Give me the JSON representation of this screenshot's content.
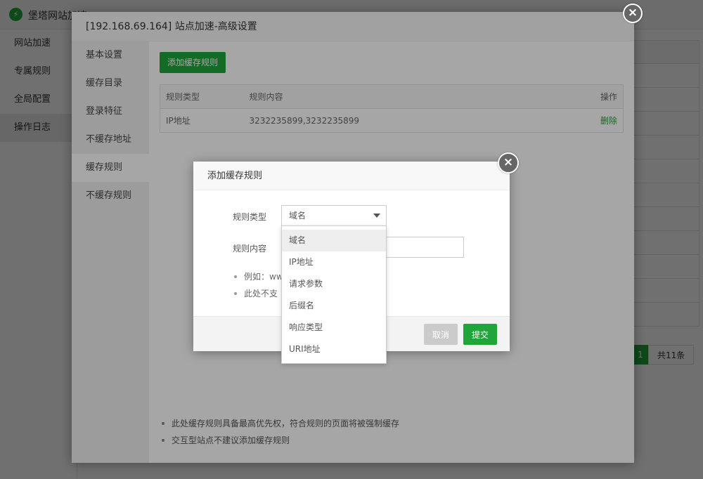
{
  "app": {
    "title": "堡塔网站加速",
    "logo_icon": "lightning-icon",
    "sidebar": [
      "网站加速",
      "专属规则",
      "全局配置",
      "操作日志"
    ],
    "active_sidebar": "操作日志",
    "pagination": {
      "current": "1",
      "total": "共11条"
    }
  },
  "settings_dialog": {
    "title": "[192.168.69.164] 站点加速-高级设置",
    "close_icon": "close-icon",
    "tabs": [
      "基本设置",
      "缓存目录",
      "登录特征",
      "不缓存地址",
      "缓存规则",
      "不缓存规则"
    ],
    "active_tab": "缓存规则",
    "add_rule_button": "添加缓存规则",
    "table": {
      "headers": [
        "规则类型",
        "规则内容",
        "操作"
      ],
      "rows": [
        {
          "type": "IP地址",
          "content": "3232235899,3232235899",
          "action": "删除"
        }
      ]
    },
    "tips": [
      "此处缓存规则具备最高优先权，符合规则的页面将被强制缓存",
      "交互型站点不建议添加缓存规则"
    ]
  },
  "add_rule_dialog": {
    "title": "添加缓存规则",
    "close_icon": "close-icon",
    "type_label": "规则类型",
    "type_value": "域名",
    "content_label": "规则内容",
    "content_value": "",
    "tips": [
      "例如：ww",
      "此处不支"
    ],
    "cancel_button": "取消",
    "submit_button": "提交",
    "dropdown_options": [
      "域名",
      "IP地址",
      "请求参数",
      "后缀名",
      "响应类型",
      "URI地址"
    ],
    "dropdown_selected": "域名"
  },
  "colors": {
    "accent": "#20a53a",
    "overlay_close": "#666666"
  }
}
